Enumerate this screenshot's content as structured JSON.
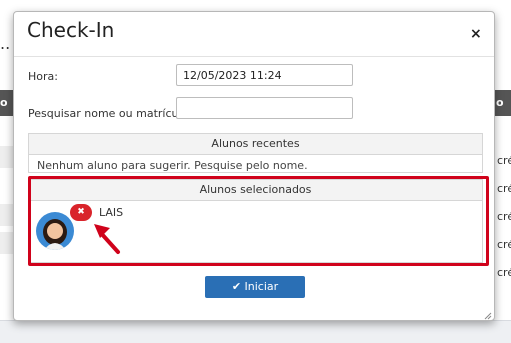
{
  "background": {
    "header_left": "o d",
    "header_right": "o",
    "row_suffix": "cré"
  },
  "modal": {
    "title": "Check-In",
    "close_label": "×",
    "hora_label": "Hora:",
    "hora_value": "12/05/2023 11:24",
    "search_label": "Pesquisar nome ou matrícula:",
    "search_value": "",
    "recentes": {
      "title": "Alunos recentes",
      "message": "Nenhum aluno para sugerir. Pesquise pelo nome."
    },
    "selecionados": {
      "title": "Alunos selecionados",
      "students": [
        {
          "name": "LAIS",
          "remove_icon": "close-icon"
        }
      ]
    },
    "start_button": {
      "icon": "checkmark-icon",
      "label": "Iniciar"
    }
  },
  "colors": {
    "highlight": "#d0021b",
    "primary_button": "#2a6fb5",
    "remove_badge": "#d9242b"
  }
}
